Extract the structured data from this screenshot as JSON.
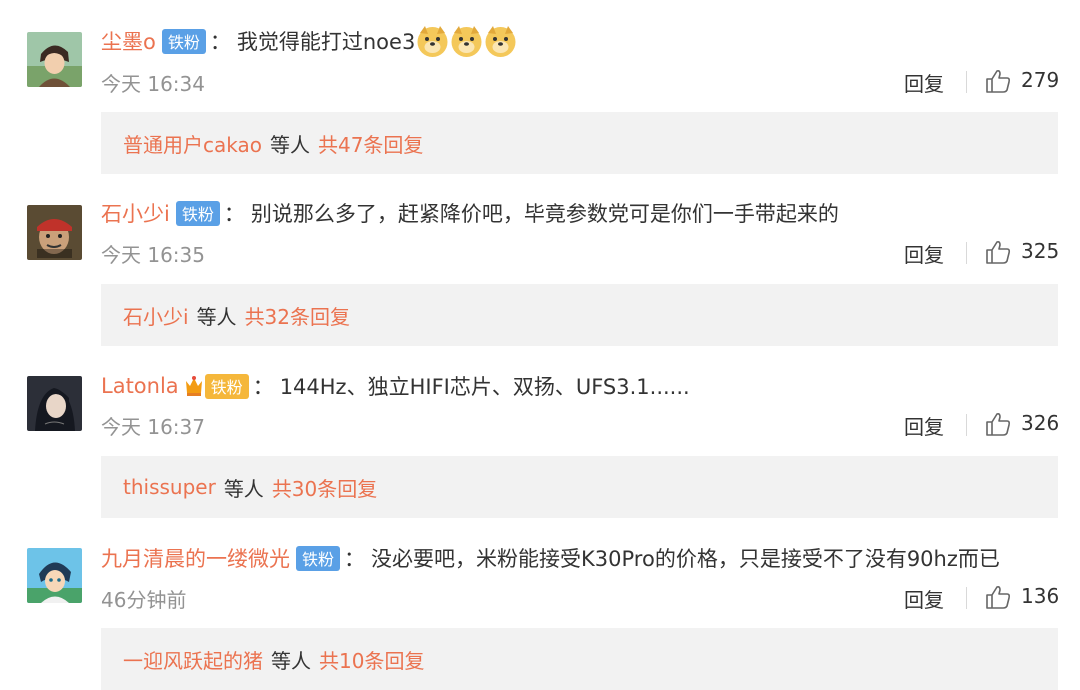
{
  "comments": [
    {
      "username": "尘墨o",
      "badge": "铁粉",
      "colon": "：",
      "text": "我觉得能打过noe3",
      "emoji_count": 3,
      "emoji_icon": "doge-icon",
      "time": "今天 16:34",
      "reply_label": "回复",
      "likes": "279",
      "reply_preview": {
        "user": "普通用户cakao",
        "etc": "等人",
        "total": "共47条回复"
      }
    },
    {
      "username": "石小少i",
      "badge": "铁粉",
      "colon": "：",
      "text": "别说那么多了，赶紧降价吧，毕竟参数党可是你们一手带起来的",
      "time": "今天 16:35",
      "reply_label": "回复",
      "likes": "325",
      "reply_preview": {
        "user": "石小少i",
        "etc": "等人",
        "total": "共32条回复"
      }
    },
    {
      "username": "Latonla",
      "badge": "铁粉",
      "badge_style": "gold-crown",
      "colon": "：",
      "text": "144Hz、独立HIFI芯片、双扬、UFS3.1......",
      "time": "今天 16:37",
      "reply_label": "回复",
      "likes": "326",
      "reply_preview": {
        "user": "thissuper",
        "etc": "等人",
        "total": "共30条回复"
      }
    },
    {
      "username": "九月清晨的一缕微光",
      "badge": "铁粉",
      "colon": "：",
      "text": "没必要吧，米粉能接受K30Pro的价格，只是接受不了没有90hz而已",
      "time": "46分钟前",
      "reply_label": "回复",
      "likes": "136",
      "reply_preview": {
        "user": "一迎风跃起的猪",
        "etc": "等人",
        "total": "共10条回复"
      }
    }
  ],
  "colors": {
    "username": "#eb7350",
    "badge": "#5aa0e6",
    "badge_gold": "#f5b73b",
    "time": "#939393",
    "reply_box_bg": "#f2f2f2"
  },
  "icons": {
    "like": "thumbs-up-icon",
    "crown": "crown-icon"
  }
}
